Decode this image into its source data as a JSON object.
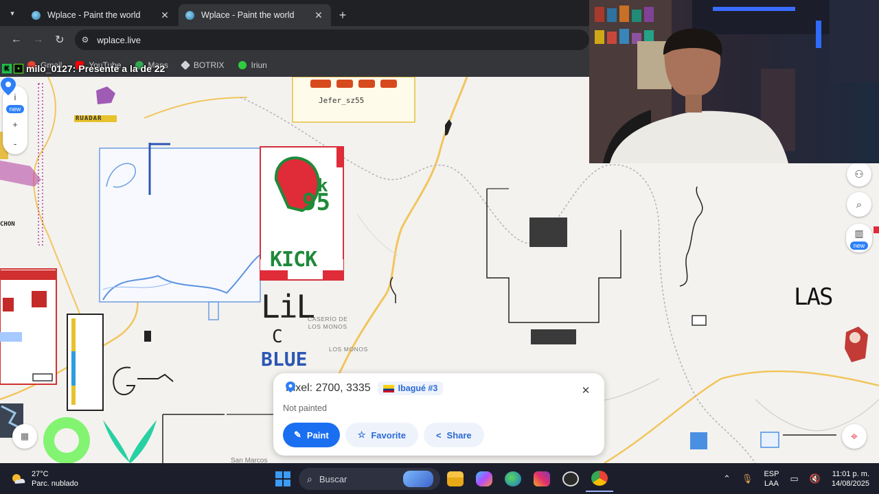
{
  "browser": {
    "tabs": [
      {
        "title": "Wplace - Paint the world",
        "active": false
      },
      {
        "title": "Wplace - Paint the world",
        "active": true
      }
    ],
    "url": "wplace.live",
    "bookmarks": [
      "Gmail",
      "YouTube",
      "Maps",
      "BOTRIX",
      "Iriun"
    ]
  },
  "chat_overlay": {
    "username": "milo_0127",
    "message": ": Presente a la de 22"
  },
  "map": {
    "labels": {
      "caserio_line1": "CASERÍO DE",
      "caserio_line2": "LOS MONOS",
      "los_monos": "LOS MONOS",
      "san_marcos": "San Marcos"
    },
    "art_text": {
      "kick": "KICK",
      "dk": "Dk",
      "dk_num": "95",
      "lil": "LiL",
      "c": "C",
      "blue": "BLUE",
      "las": "LAS",
      "jefer": "Jefer_sz55",
      "ruadar": "RUADAR",
      "chon": "CHON"
    },
    "left_controls": {
      "info": "i",
      "new_badge": "new",
      "zoom_in": "+",
      "zoom_out": "-"
    },
    "right_controls": {
      "new_badge": "new"
    }
  },
  "pixel_panel": {
    "title": "Pixel: 2700, 3335",
    "region": "Ibagué #3",
    "status": "Not painted",
    "actions": {
      "paint": "Paint",
      "favorite": "Favorite",
      "share": "Share"
    }
  },
  "taskbar": {
    "temperature": "27°C",
    "weather": "Parc. nublado",
    "search_placeholder": "Buscar",
    "lang_line1": "ESP",
    "lang_line2": "LAA",
    "time": "11:01 p. m.",
    "date": "14/08/2025"
  },
  "colors": {
    "accent": "#1a6ff0",
    "chip_text": "#2b6ad6",
    "map_bg": "#f3f2ef",
    "road": "#f2c55c"
  }
}
